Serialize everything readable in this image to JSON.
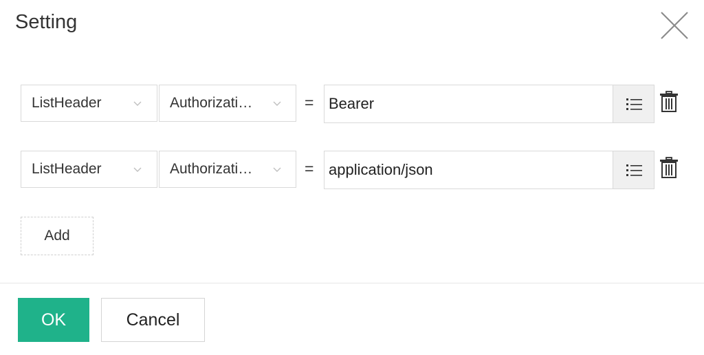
{
  "dialog": {
    "title": "Setting"
  },
  "rows": [
    {
      "type_value": "ListHeader",
      "key_value": "Authorizati…",
      "operator": "=",
      "value": "Bearer"
    },
    {
      "type_value": "ListHeader",
      "key_value": "Authorizati…",
      "operator": "=",
      "value": "application/json"
    }
  ],
  "actions": {
    "add_label": "Add",
    "ok_label": "OK",
    "cancel_label": "Cancel"
  },
  "icons": {
    "close": "close-icon",
    "chevron": "chevron-down-icon",
    "list": "list-icon",
    "trash": "trash-icon"
  },
  "colors": {
    "primary": "#1fb28a",
    "border": "#d9d9d9",
    "button_bg": "#f0f0f0"
  }
}
